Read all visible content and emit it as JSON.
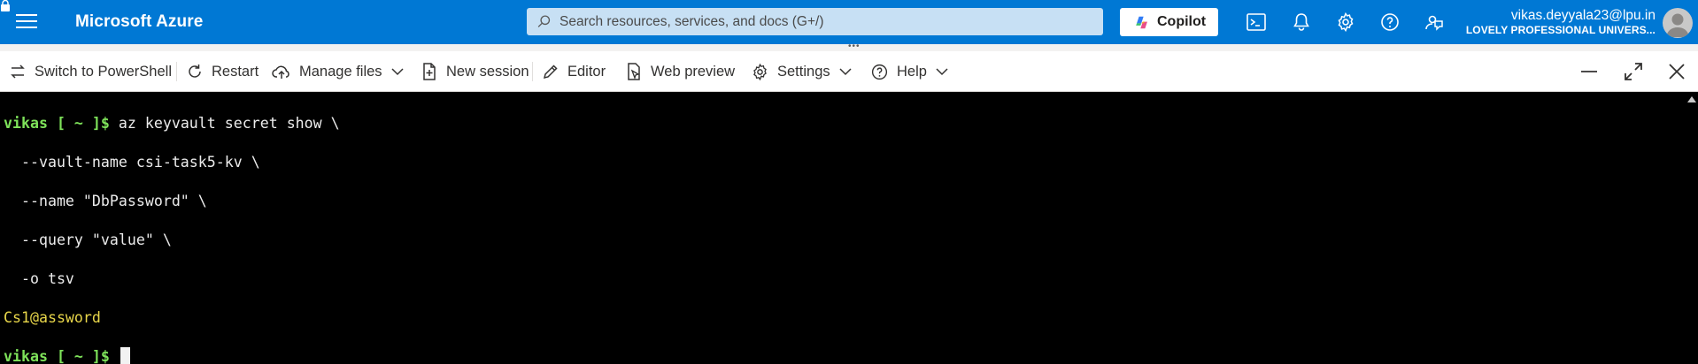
{
  "topbar": {
    "brand": "Microsoft Azure",
    "search_placeholder": "Search resources, services, and docs (G+/)",
    "copilot_label": "Copilot",
    "icons": [
      "cloud-shell-icon",
      "bell-icon",
      "gear-icon",
      "help-icon",
      "feedback-icon"
    ],
    "user": {
      "name": "vikas.deyyala23@lpu.in",
      "tenant": "LOVELY PROFESSIONAL UNIVERS..."
    },
    "color": "#0078d4"
  },
  "toolbar": {
    "switch_label": "Switch to PowerShell",
    "restart_label": "Restart",
    "manage_files_label": "Manage files",
    "new_session_label": "New session",
    "editor_label": "Editor",
    "web_preview_label": "Web preview",
    "settings_label": "Settings",
    "help_label": "Help"
  },
  "terminal": {
    "prompt": "vikas [ ~ ]$",
    "command_lines": [
      " az keyvault secret show \\",
      "  --vault-name csi-task5-kv \\",
      "  --name \"DbPassword\" \\",
      "  --query \"value\" \\",
      "  -o tsv"
    ],
    "output": "Cs1@assword",
    "prompt_color": "#7ee25a",
    "output_color": "#e8d64a"
  }
}
